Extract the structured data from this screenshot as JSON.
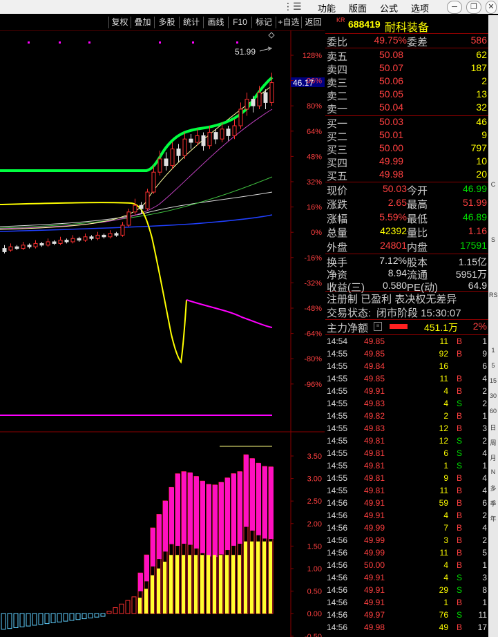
{
  "menu": {
    "items": [
      "功能",
      "版面",
      "公式",
      "选项"
    ]
  },
  "toolbar": {
    "buttons": [
      "复权",
      "叠加",
      "多股",
      "统计",
      "画线",
      "F10",
      "标记",
      "+自选",
      "返回"
    ]
  },
  "chart": {
    "price_axis": [
      "128%",
      "96%",
      "80%",
      "64%",
      "48%",
      "32%",
      "16%",
      "0%",
      "-16%",
      "-32%",
      "-48%",
      "-64%",
      "-80%",
      "-96%"
    ],
    "vol_axis": [
      "3.50",
      "3.00",
      "2.50",
      "2.00",
      "1.50",
      "1.00",
      "0.50",
      "0.00",
      "-0.50"
    ],
    "high_label": "51.99",
    "price_tag": "46.17",
    "main_candles": [
      [
        0.36,
        0.34,
        0.38,
        0.33
      ],
      [
        0.35,
        0.37,
        0.39,
        0.34
      ],
      [
        0.37,
        0.36,
        0.38,
        0.35
      ],
      [
        0.36,
        0.38,
        0.4,
        0.35
      ],
      [
        0.38,
        0.37,
        0.39,
        0.36
      ],
      [
        0.37,
        0.39,
        0.41,
        0.36
      ],
      [
        0.39,
        0.38,
        0.4,
        0.37
      ],
      [
        0.38,
        0.4,
        0.42,
        0.37
      ],
      [
        0.4,
        0.39,
        0.41,
        0.38
      ],
      [
        0.39,
        0.41,
        0.43,
        0.38
      ],
      [
        0.41,
        0.4,
        0.42,
        0.39
      ],
      [
        0.4,
        0.42,
        0.44,
        0.39
      ],
      [
        0.42,
        0.41,
        0.43,
        0.4
      ],
      [
        0.41,
        0.43,
        0.45,
        0.4
      ],
      [
        0.43,
        0.42,
        0.44,
        0.41
      ],
      [
        0.42,
        0.44,
        0.46,
        0.41
      ],
      [
        0.44,
        0.43,
        0.45,
        0.42
      ],
      [
        0.43,
        0.45,
        0.47,
        0.42
      ],
      [
        0.45,
        0.44,
        0.46,
        0.43
      ],
      [
        0.44,
        0.5,
        0.52,
        0.43
      ],
      [
        0.5,
        0.58,
        0.6,
        0.49
      ],
      [
        0.58,
        0.62,
        0.66,
        0.56
      ],
      [
        0.62,
        0.6,
        0.64,
        0.57
      ],
      [
        0.6,
        0.7,
        0.72,
        0.59
      ],
      [
        0.7,
        0.82,
        0.86,
        0.69
      ],
      [
        0.82,
        0.9,
        0.95,
        0.8
      ],
      [
        0.9,
        0.86,
        0.94,
        0.83
      ],
      [
        0.86,
        0.96,
        1.0,
        0.84
      ],
      [
        0.96,
        0.92,
        0.99,
        0.88
      ],
      [
        0.92,
        1.02,
        1.06,
        0.9
      ],
      [
        1.02,
        1.0,
        1.05,
        0.96
      ],
      [
        1.0,
        1.04,
        1.08,
        0.98
      ],
      [
        1.04,
        0.98,
        1.06,
        0.95
      ],
      [
        0.98,
        1.06,
        1.1,
        0.96
      ],
      [
        1.06,
        1.02,
        1.08,
        0.99
      ],
      [
        1.02,
        1.08,
        1.12,
        1.0
      ],
      [
        1.08,
        1.04,
        1.1,
        1.01
      ],
      [
        1.04,
        1.1,
        1.14,
        1.02
      ],
      [
        1.1,
        1.2,
        1.24,
        1.08
      ],
      [
        1.2,
        1.26,
        1.3,
        1.16
      ],
      [
        1.26,
        1.22,
        1.28,
        1.18
      ],
      [
        1.22,
        1.3,
        1.34,
        1.2
      ],
      [
        1.3,
        1.24,
        1.32,
        1.2
      ],
      [
        1.24,
        1.36,
        1.42,
        1.22
      ]
    ]
  },
  "quote": {
    "code": "688419",
    "name": "耐科装备",
    "tag": "KR",
    "weibi_label": "委比",
    "weibi": "49.75%",
    "weicha_label": "委差",
    "weicha": "586",
    "asks": [
      {
        "label": "卖五",
        "price": "50.08",
        "vol": "62"
      },
      {
        "label": "卖四",
        "price": "50.07",
        "vol": "187"
      },
      {
        "label": "卖三",
        "price": "50.06",
        "vol": "2"
      },
      {
        "label": "卖二",
        "price": "50.05",
        "vol": "13"
      },
      {
        "label": "卖一",
        "price": "50.04",
        "vol": "32"
      }
    ],
    "bids": [
      {
        "label": "买一",
        "price": "50.03",
        "vol": "46"
      },
      {
        "label": "买二",
        "price": "50.01",
        "vol": "9"
      },
      {
        "label": "买三",
        "price": "50.00",
        "vol": "797"
      },
      {
        "label": "买四",
        "price": "49.99",
        "vol": "10"
      },
      {
        "label": "买五",
        "price": "49.98",
        "vol": "20"
      }
    ],
    "stats": [
      {
        "l1": "现价",
        "v1": "50.03",
        "c1": "#ff4040",
        "l2": "今开",
        "v2": "46.99",
        "c2": "#00e000"
      },
      {
        "l1": "涨跌",
        "v1": "2.65",
        "c1": "#ff4040",
        "l2": "最高",
        "v2": "51.99",
        "c2": "#ff4040"
      },
      {
        "l1": "涨幅",
        "v1": "5.59%",
        "c1": "#ff4040",
        "l2": "最低",
        "v2": "46.89",
        "c2": "#00e000"
      },
      {
        "l1": "总量",
        "v1": "42392",
        "c1": "#ffff00",
        "l2": "量比",
        "v2": "1.16",
        "c2": "#ff4040"
      },
      {
        "l1": "外盘",
        "v1": "24801",
        "c1": "#ff4040",
        "l2": "内盘",
        "v2": "17591",
        "c2": "#00e000"
      }
    ],
    "fin": [
      {
        "l1": "换手",
        "v1": "7.12%",
        "l2": "股本",
        "v2": "1.15亿"
      },
      {
        "l1": "净资",
        "v1": "8.94",
        "l2": "流通",
        "v2": "5951万"
      },
      {
        "l1": "收益(三)",
        "v1": "0.580",
        "l2": "PE(动)",
        "v2": "64.9"
      }
    ],
    "register": "注册制 已盈利 表决权无差异",
    "trade_state_label": "交易状态:",
    "trade_state": "闭市阶段 15:30:07",
    "main_flow_label": "主力净额",
    "main_flow_value": "451.1万",
    "main_flow_pct": "2%"
  },
  "ticks": [
    {
      "t": "14:54",
      "p": "49.85",
      "v": "11",
      "s": "B",
      "n": "1"
    },
    {
      "t": "14:55",
      "p": "49.85",
      "v": "92",
      "s": "B",
      "n": "9"
    },
    {
      "t": "14:55",
      "p": "49.84",
      "v": "16",
      "s": "",
      "n": "6"
    },
    {
      "t": "14:55",
      "p": "49.85",
      "v": "11",
      "s": "B",
      "n": "4"
    },
    {
      "t": "14:55",
      "p": "49.91",
      "v": "4",
      "s": "B",
      "n": "2"
    },
    {
      "t": "14:55",
      "p": "49.83",
      "v": "4",
      "s": "S",
      "n": "2"
    },
    {
      "t": "14:55",
      "p": "49.82",
      "v": "2",
      "s": "B",
      "n": "1"
    },
    {
      "t": "14:55",
      "p": "49.83",
      "v": "12",
      "s": "B",
      "n": "3"
    },
    {
      "t": "14:55",
      "p": "49.81",
      "v": "12",
      "s": "S",
      "n": "2"
    },
    {
      "t": "14:55",
      "p": "49.81",
      "v": "6",
      "s": "S",
      "n": "4"
    },
    {
      "t": "14:55",
      "p": "49.81",
      "v": "1",
      "s": "S",
      "n": "1"
    },
    {
      "t": "14:55",
      "p": "49.81",
      "v": "9",
      "s": "B",
      "n": "4"
    },
    {
      "t": "14:55",
      "p": "49.81",
      "v": "11",
      "s": "B",
      "n": "4"
    },
    {
      "t": "14:56",
      "p": "49.91",
      "v": "59",
      "s": "B",
      "n": "6"
    },
    {
      "t": "14:56",
      "p": "49.91",
      "v": "4",
      "s": "B",
      "n": "2"
    },
    {
      "t": "14:56",
      "p": "49.99",
      "v": "7",
      "s": "B",
      "n": "4"
    },
    {
      "t": "14:56",
      "p": "49.99",
      "v": "3",
      "s": "B",
      "n": "2"
    },
    {
      "t": "14:56",
      "p": "49.99",
      "v": "11",
      "s": "B",
      "n": "5"
    },
    {
      "t": "14:56",
      "p": "50.00",
      "v": "4",
      "s": "B",
      "n": "1"
    },
    {
      "t": "14:56",
      "p": "49.91",
      "v": "4",
      "s": "S",
      "n": "3"
    },
    {
      "t": "14:56",
      "p": "49.91",
      "v": "29",
      "s": "S",
      "n": "8"
    },
    {
      "t": "14:56",
      "p": "49.91",
      "v": "1",
      "s": "B",
      "n": "1"
    },
    {
      "t": "14:56",
      "p": "49.97",
      "v": "76",
      "s": "S",
      "n": "11"
    },
    {
      "t": "14:56",
      "p": "49.98",
      "v": "49",
      "s": "B",
      "n": "17"
    }
  ],
  "side_icons": [
    "C",
    "S",
    "RS",
    "1",
    "5",
    "15",
    "30",
    "60",
    "日",
    "周",
    "月",
    "N",
    "多",
    "季",
    "年"
  ]
}
